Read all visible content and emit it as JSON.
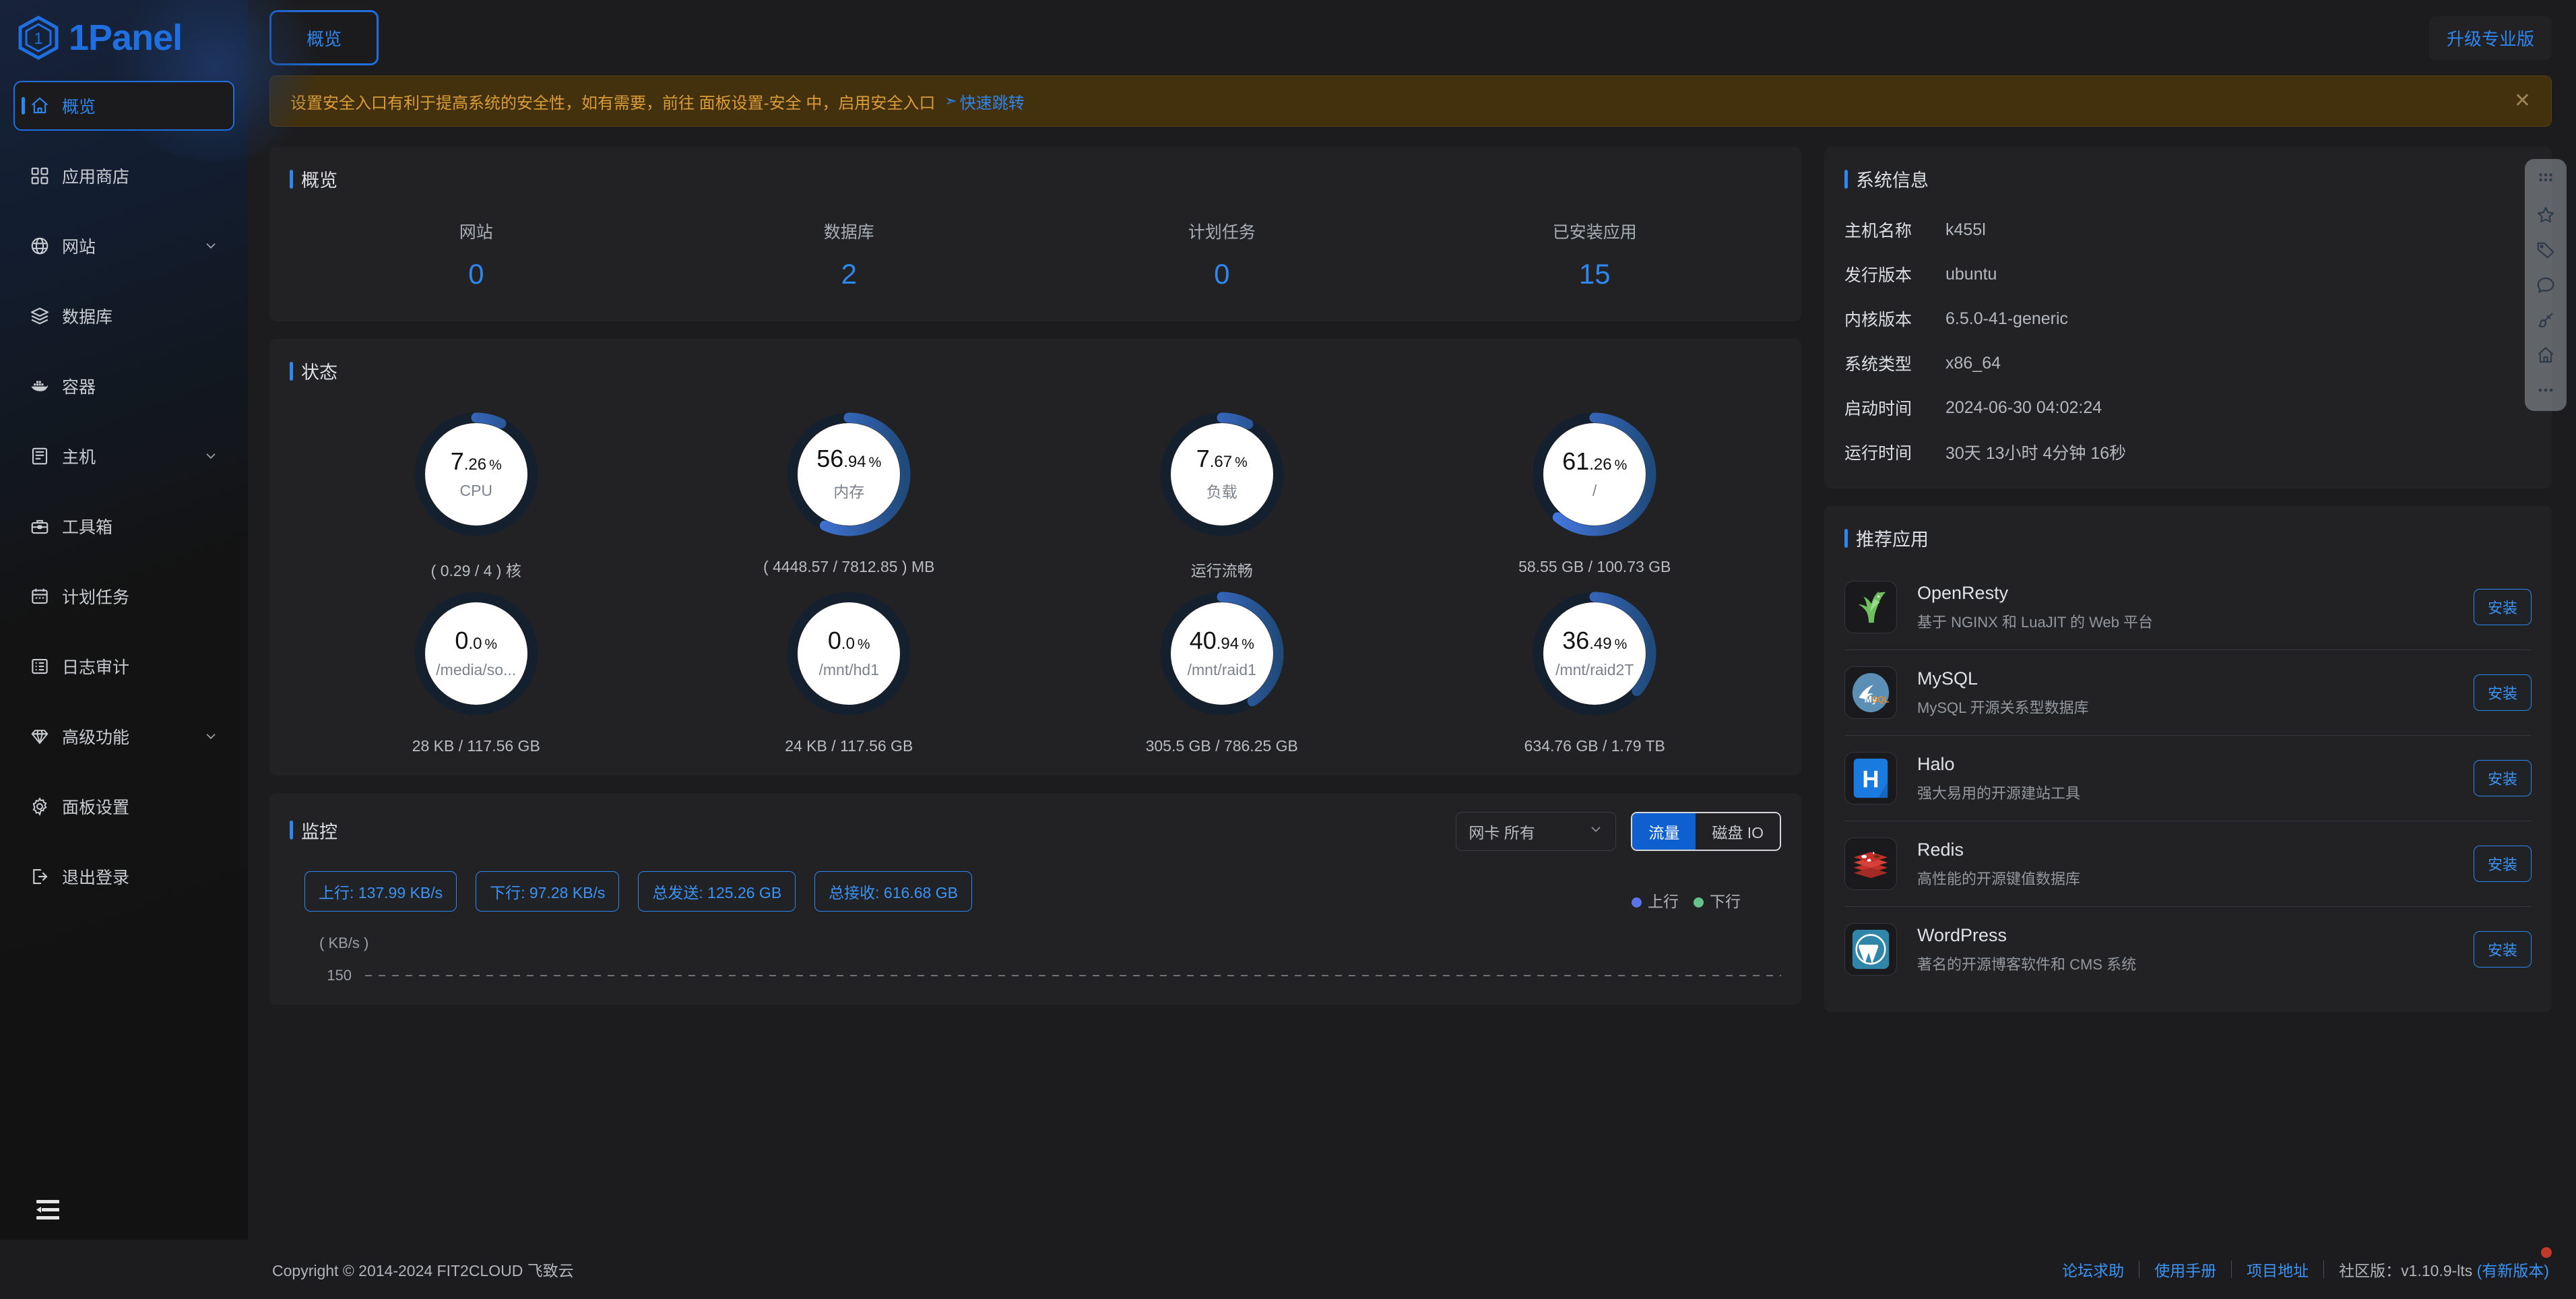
{
  "brand": {
    "name": "1Panel",
    "logo_icon": "1panel-hex-logo"
  },
  "sidebar": {
    "items": [
      {
        "label": "概览",
        "icon": "home-icon",
        "active": true,
        "expandable": false
      },
      {
        "label": "应用商店",
        "icon": "grid-apps-icon",
        "active": false,
        "expandable": false
      },
      {
        "label": "网站",
        "icon": "globe-icon",
        "active": false,
        "expandable": true
      },
      {
        "label": "数据库",
        "icon": "database-layers-icon",
        "active": false,
        "expandable": false
      },
      {
        "label": "容器",
        "icon": "docker-whale-icon",
        "active": false,
        "expandable": false
      },
      {
        "label": "主机",
        "icon": "server-icon",
        "active": false,
        "expandable": true
      },
      {
        "label": "工具箱",
        "icon": "toolbox-icon",
        "active": false,
        "expandable": false
      },
      {
        "label": "计划任务",
        "icon": "calendar-icon",
        "active": false,
        "expandable": false
      },
      {
        "label": "日志审计",
        "icon": "log-list-icon",
        "active": false,
        "expandable": false
      },
      {
        "label": "高级功能",
        "icon": "diamond-icon",
        "active": false,
        "expandable": true
      },
      {
        "label": "面板设置",
        "icon": "gear-icon",
        "active": false,
        "expandable": false
      },
      {
        "label": "退出登录",
        "icon": "logout-icon",
        "active": false,
        "expandable": false
      }
    ],
    "collapse_icon": "hamburger-collapse-icon"
  },
  "topbar": {
    "tab_label": "概览",
    "upgrade_label": "升级专业版"
  },
  "alert": {
    "text": "设置安全入口有利于提高系统的安全性，如有需要，前往 面板设置-安全 中，启用安全入口",
    "link_label": "快速跳转",
    "link_icon": "navigate-arrow-icon",
    "close_icon": "close-icon",
    "bg_color": "#43300d",
    "text_color": "#d99c38"
  },
  "overview": {
    "title": "概览",
    "stats": [
      {
        "label": "网站",
        "value": "0"
      },
      {
        "label": "数据库",
        "value": "2"
      },
      {
        "label": "计划任务",
        "value": "0"
      },
      {
        "label": "已安装应用",
        "value": "15"
      }
    ],
    "accent_color": "#2e86ef"
  },
  "status": {
    "title": "状态",
    "gauges": [
      {
        "name": "CPU",
        "int": "7",
        "dec": ".26",
        "unit": "%",
        "percent": 7.26,
        "sub": "( 0.29 / 4 ) 核"
      },
      {
        "name": "内存",
        "int": "56",
        "dec": ".94",
        "unit": "%",
        "percent": 56.94,
        "sub": "( 4448.57 / 7812.85 ) MB"
      },
      {
        "name": "负载",
        "int": "7",
        "dec": ".67",
        "unit": "%",
        "percent": 7.67,
        "sub": "运行流畅"
      },
      {
        "name": "/",
        "int": "61",
        "dec": ".26",
        "unit": "%",
        "percent": 61.26,
        "sub": "58.55 GB / 100.73 GB"
      },
      {
        "name": "/media/so...",
        "int": "0",
        "dec": ".0",
        "unit": "%",
        "percent": 0,
        "sub": "28 KB / 117.56 GB"
      },
      {
        "name": "/mnt/hd1",
        "int": "0",
        "dec": ".0",
        "unit": "%",
        "percent": 0,
        "sub": "24 KB / 117.56 GB"
      },
      {
        "name": "/mnt/raid1",
        "int": "40",
        "dec": ".94",
        "unit": "%",
        "percent": 40.94,
        "sub": "305.5 GB / 786.25 GB"
      },
      {
        "name": "/mnt/raid2T",
        "int": "36",
        "dec": ".49",
        "unit": "%",
        "percent": 36.49,
        "sub": "634.76 GB / 1.79 TB"
      }
    ]
  },
  "monitor": {
    "title": "监控",
    "select_value": "网卡 所有",
    "select_icon": "chevron-down-icon",
    "tabs": [
      {
        "label": "流量",
        "active": true
      },
      {
        "label": "磁盘 IO",
        "active": false
      }
    ],
    "chips": [
      "上行: 137.99 KB/s",
      "下行: 97.28 KB/s",
      "总发送: 125.26 GB",
      "总接收: 616.68 GB"
    ],
    "legend": [
      {
        "label": "上行",
        "color": "#5b73e8"
      },
      {
        "label": "下行",
        "color": "#67c28a"
      }
    ]
  },
  "chart_data": {
    "type": "line",
    "title": "监控",
    "ylabel": "( KB/s )",
    "yticks": [
      "150"
    ],
    "ylim": [
      0,
      150
    ],
    "series": [
      {
        "name": "上行",
        "color": "#5b73e8",
        "values": []
      },
      {
        "name": "下行",
        "color": "#67c28a",
        "values": []
      }
    ],
    "grid": true,
    "legend_position": "top-right"
  },
  "system_info": {
    "title": "系统信息",
    "rows": [
      {
        "key": "主机名称",
        "value": "k455l"
      },
      {
        "key": "发行版本",
        "value": "ubuntu"
      },
      {
        "key": "内核版本",
        "value": "6.5.0-41-generic"
      },
      {
        "key": "系统类型",
        "value": "x86_64"
      },
      {
        "key": "启动时间",
        "value": "2024-06-30 04:02:24"
      },
      {
        "key": "运行时间",
        "value": "30天 13小时 4分钟 16秒"
      }
    ]
  },
  "recommend": {
    "title": "推荐应用",
    "install_label": "安装",
    "apps": [
      {
        "name": "OpenResty",
        "desc": "基于 NGINX 和 LuaJIT 的 Web 平台",
        "icon": "openresty-icon"
      },
      {
        "name": "MySQL",
        "desc": "MySQL 开源关系型数据库",
        "icon": "mysql-icon"
      },
      {
        "name": "Halo",
        "desc": "强大易用的开源建站工具",
        "icon": "halo-icon"
      },
      {
        "name": "Redis",
        "desc": "高性能的开源键值数据库",
        "icon": "redis-icon"
      },
      {
        "name": "WordPress",
        "desc": "著名的开源博客软件和 CMS 系统",
        "icon": "wordpress-icon"
      }
    ]
  },
  "floatbar": {
    "icons": [
      "apps-grid-icon",
      "star-icon",
      "tag-icon",
      "comment-icon",
      "brush-icon",
      "home-icon",
      "more-dots-icon"
    ]
  },
  "footer": {
    "copyright": "Copyright © 2014-2024 FIT2CLOUD 飞致云",
    "links": [
      "论坛求助",
      "使用手册",
      "项目地址"
    ],
    "version_prefix": "社区版：",
    "version": "v1.10.9-lts",
    "version_note": "(有新版本)"
  }
}
